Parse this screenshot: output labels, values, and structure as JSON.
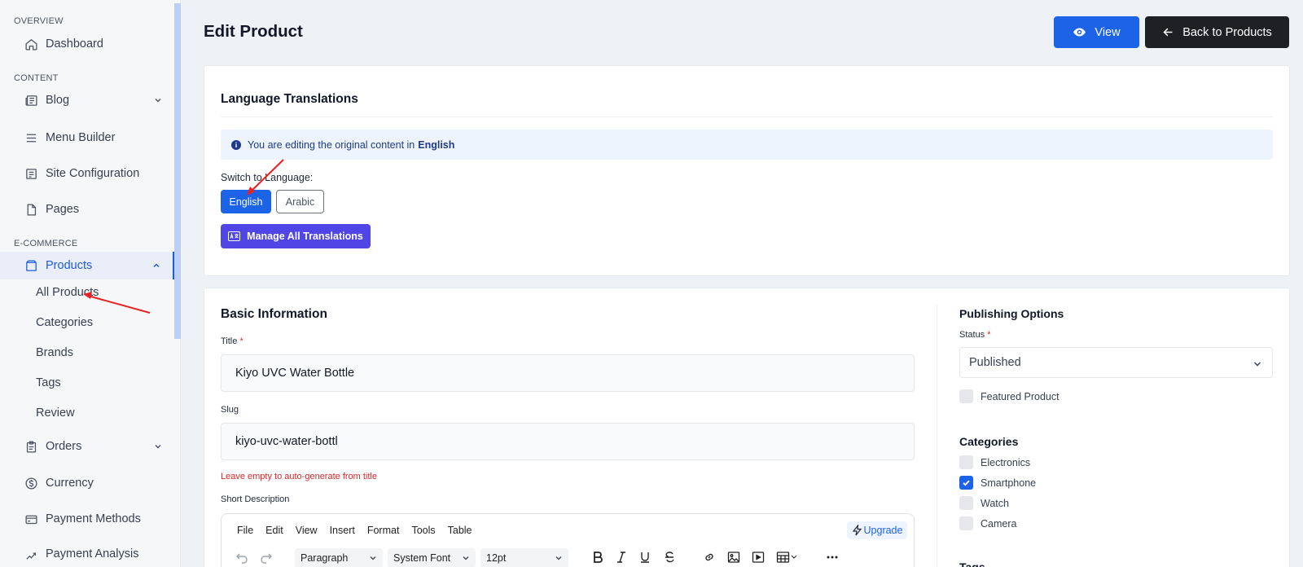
{
  "sidebar": {
    "sections": [
      "OVERVIEW",
      "CONTENT",
      "E-COMMERCE"
    ],
    "items": {
      "dashboard": "Dashboard",
      "blog": "Blog",
      "menu_builder": "Menu Builder",
      "site_configuration": "Site Configuration",
      "pages": "Pages",
      "products": "Products",
      "orders": "Orders",
      "currency": "Currency",
      "payment_methods": "Payment Methods",
      "payment_analysis": "Payment Analysis"
    },
    "product_subitems": [
      "All Products",
      "Categories",
      "Brands",
      "Tags",
      "Review"
    ]
  },
  "header": {
    "title": "Edit Product",
    "view_label": "View",
    "back_label": "Back to Products"
  },
  "translations": {
    "heading": "Language Translations",
    "info_text": "You are editing the original content in",
    "info_lang": "English",
    "switch_label": "Switch to Language:",
    "languages": [
      "English",
      "Arabic"
    ],
    "selected_language": "English",
    "manage_label": "Manage All Translations"
  },
  "basic": {
    "heading": "Basic Information",
    "title_label": "Title",
    "required_mark": "*",
    "title_value": "Kiyo UVC Water Bottle",
    "slug_label": "Slug",
    "slug_value": "kiyo-uvc-water-bottl",
    "slug_hint": "Leave empty to auto-generate from title",
    "short_desc_label": "Short Description"
  },
  "editor": {
    "menu": [
      "File",
      "Edit",
      "View",
      "Insert",
      "Format",
      "Tools",
      "Table"
    ],
    "upgrade_label": "Upgrade",
    "block_format": "Paragraph",
    "font_family": "System Font",
    "font_size": "12pt"
  },
  "publishing": {
    "heading": "Publishing Options",
    "status_label": "Status",
    "status_value": "Published",
    "featured_label": "Featured Product",
    "featured_checked": false
  },
  "categories": {
    "heading": "Categories",
    "items": [
      {
        "label": "Electronics",
        "checked": false
      },
      {
        "label": "Smartphone",
        "checked": true
      },
      {
        "label": "Watch",
        "checked": false
      },
      {
        "label": "Camera",
        "checked": false
      }
    ]
  },
  "tags": {
    "heading": "Tags"
  },
  "colors": {
    "primary": "#1d63e8",
    "dark_button": "#1f2023",
    "indigo": "#4f46e5",
    "danger": "#dc2626",
    "annotation_arrow": "#e8211f"
  }
}
